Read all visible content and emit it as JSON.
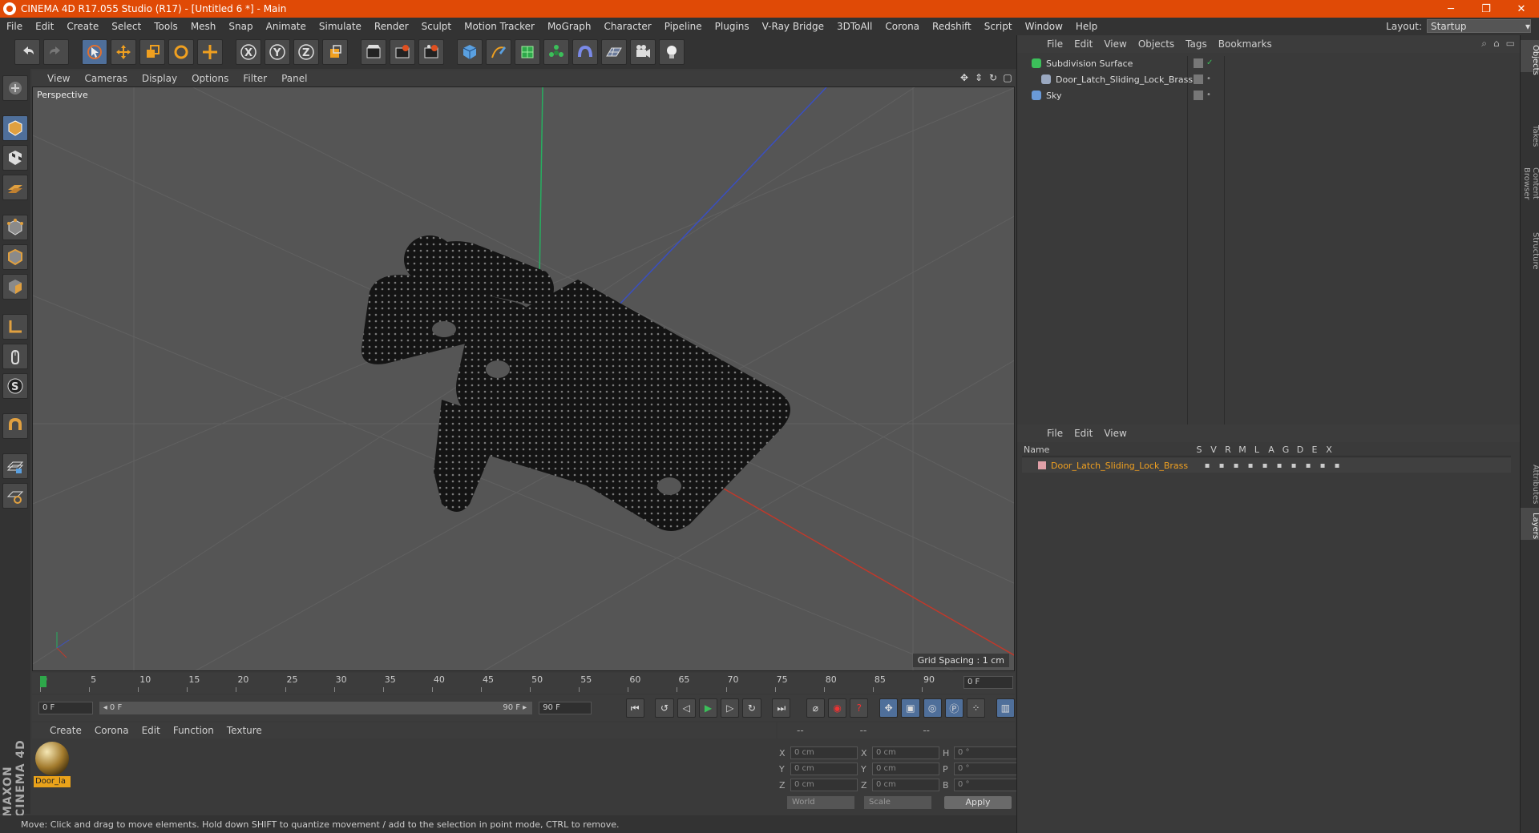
{
  "title": "CINEMA 4D R17.055 Studio (R17) - [Untitled 6 *] - Main",
  "window_controls": {
    "minimize": "─",
    "restore": "❐",
    "close": "✕"
  },
  "menu": [
    "File",
    "Edit",
    "Create",
    "Select",
    "Tools",
    "Mesh",
    "Snap",
    "Animate",
    "Simulate",
    "Render",
    "Sculpt",
    "Motion Tracker",
    "MoGraph",
    "Character",
    "Pipeline",
    "Plugins",
    "V-Ray Bridge",
    "3DToAll",
    "Corona",
    "Redshift",
    "Script",
    "Window",
    "Help"
  ],
  "layout": {
    "label": "Layout:",
    "value": "Startup"
  },
  "toolbar_icons": [
    "undo-icon",
    "redo-icon",
    "select-arrow-icon",
    "move-icon",
    "scale-icon",
    "rotate-icon",
    "live-select-icon",
    "x-axis-icon",
    "y-axis-icon",
    "z-axis-icon",
    "coordinate-system-icon",
    "render-view-icon",
    "render-picture-viewer-icon",
    "render-settings-icon",
    "cube-icon",
    "pen-icon",
    "subdivision-icon",
    "array-icon",
    "deformer-icon",
    "floor-icon",
    "camera-icon",
    "light-icon"
  ],
  "toolbar_glyphs": {
    "x": "X",
    "y": "Y",
    "z": "Z"
  },
  "viewport": {
    "menu": [
      "View",
      "Cameras",
      "Display",
      "Options",
      "Filter",
      "Panel"
    ],
    "label": "Perspective",
    "grid_spacing": "Grid Spacing : 1 cm",
    "colors": {
      "bg": "#555555",
      "grid": "#616161",
      "axis_x": "#c0392b",
      "axis_y": "#27ae60",
      "axis_z": "#3a4fc0",
      "model": "#141414",
      "dots": "#7a7a7a"
    }
  },
  "timeline": {
    "ticks": [
      "0",
      "5",
      "10",
      "15",
      "20",
      "25",
      "30",
      "35",
      "40",
      "45",
      "50",
      "55",
      "60",
      "65",
      "70",
      "75",
      "80",
      "85",
      "90"
    ],
    "end_field": "0 F"
  },
  "transport": {
    "start": "0 F",
    "slider_start": "◂ 0 F",
    "slider_end": "90 F ▸",
    "max": "90 F"
  },
  "material_manager": {
    "menu": [
      "Create",
      "Corona",
      "Edit",
      "Function",
      "Texture"
    ],
    "material_name": "Door_la"
  },
  "coords": {
    "headers": [
      "--",
      "--",
      "--"
    ],
    "rows": [
      {
        "l1": "X",
        "v1": "0 cm",
        "l2": "X",
        "v2": "0 cm",
        "l3": "H",
        "v3": "0 °"
      },
      {
        "l1": "Y",
        "v1": "0 cm",
        "l2": "Y",
        "v2": "0 cm",
        "l3": "P",
        "v3": "0 °"
      },
      {
        "l1": "Z",
        "v1": "0 cm",
        "l2": "Z",
        "v2": "0 cm",
        "l3": "B",
        "v3": "0 °"
      }
    ],
    "world": "World",
    "scale": "Scale",
    "apply": "Apply"
  },
  "status": "Move: Click and drag to move elements. Hold down SHIFT to quantize movement / add to the selection in point mode, CTRL to remove.",
  "objects": {
    "menu": [
      "File",
      "Edit",
      "View",
      "Objects",
      "Tags",
      "Bookmarks"
    ],
    "items": [
      {
        "name": "Subdivision Surface",
        "color": "#3cbf5a"
      },
      {
        "name": "Door_Latch_Sliding_Lock_Brass",
        "color": "#9aa8c0"
      },
      {
        "name": "Sky",
        "color": "#6a9ad8"
      }
    ]
  },
  "layers": {
    "menu": [
      "File",
      "Edit",
      "View"
    ],
    "name_header": "Name",
    "cols": [
      "S",
      "V",
      "R",
      "M",
      "L",
      "A",
      "G",
      "D",
      "E",
      "X"
    ],
    "item": "Door_Latch_Sliding_Lock_Brass"
  },
  "side_tabs": [
    "Objects",
    "Takes",
    "Content Browser",
    "Structure",
    "Attributes",
    "Layers"
  ],
  "brand": "MAXON CINEMA 4D"
}
